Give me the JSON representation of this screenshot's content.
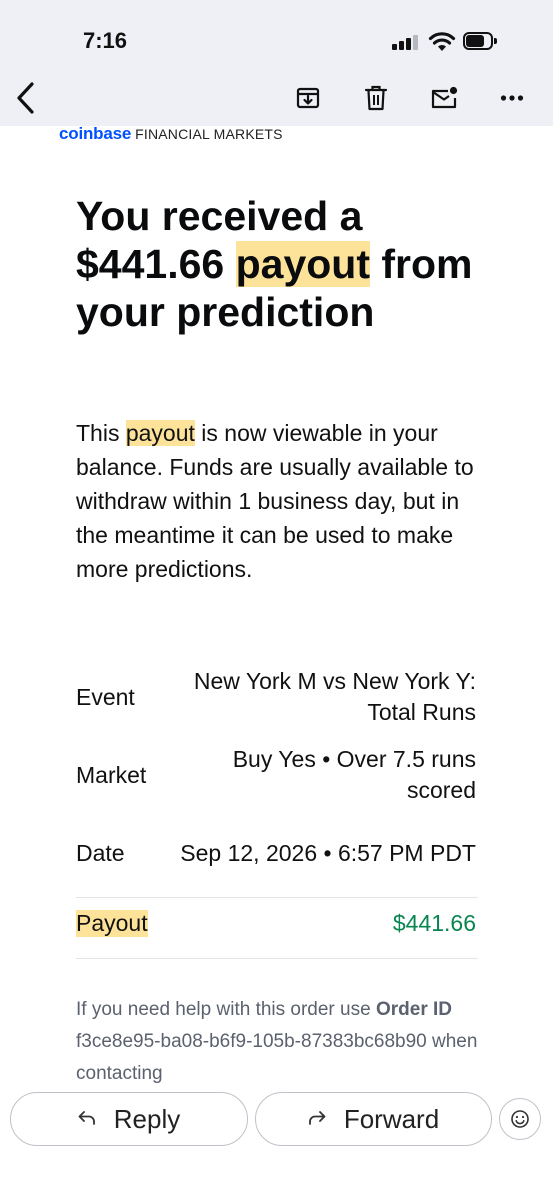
{
  "status_bar": {
    "time": "7:16"
  },
  "toolbar": {
    "back_icon": "chevron-left-icon",
    "archive_icon": "archive-icon",
    "delete_icon": "trash-icon",
    "mark_unread_icon": "mail-unread-icon",
    "more_icon": "more-horizontal-icon"
  },
  "email": {
    "brand_logo": "coinbase",
    "brand_sub": "FINANCIAL MARKETS",
    "headline_part1": "You received a $441.66 ",
    "headline_highlight": "payout",
    "headline_part2": " from your prediction",
    "body_part1": "This ",
    "body_highlight": "payout",
    "body_part2": " is now viewable in your balance. Funds are usually available to withdraw within 1 business day, but in the meantime it can be used to make more predictions.",
    "details": {
      "event_label": "Event",
      "event_value": "New York M vs New York Y: Total Runs",
      "market_label": "Market",
      "market_value": "Buy Yes • Over 7.5 runs scored",
      "date_label": "Date",
      "date_value": "Sep 12, 2026 • 6:57 PM PDT",
      "payout_label": "Payout",
      "payout_value": "$441.66"
    },
    "help_part1": "If you need help with this order use ",
    "help_bold": "Order ID",
    "help_part2": " f3ce8e95-ba08-b6f9-105b-87383bc68b90 when contacting"
  },
  "actions": {
    "reply_label": "Reply",
    "forward_label": "Forward",
    "emoji_icon": "emoji-reaction-icon"
  },
  "colors": {
    "brand_blue": "#0052ff",
    "highlight": "#fde29a",
    "payout_green": "#098551",
    "header_bg": "#eef0f6"
  }
}
